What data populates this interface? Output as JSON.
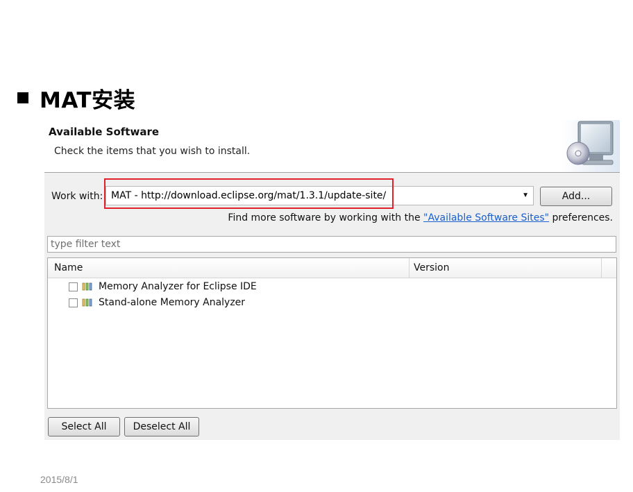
{
  "slide": {
    "title": "MAT安装",
    "date": "2015/8/1"
  },
  "dialog": {
    "title": "Available Software",
    "description": "Check the items that you wish to install.",
    "work_with_label": "Work with:",
    "work_with_value": "MAT - http://download.eclipse.org/mat/1.3.1/update-site/",
    "add_button": "Add...",
    "find_more_prefix": "Find more software by working with the ",
    "find_more_link": "\"Available Software Sites\"",
    "find_more_suffix": " preferences.",
    "filter_placeholder": "type filter text",
    "table": {
      "columns": [
        "Name",
        "Version"
      ],
      "rows": [
        {
          "name": "Memory Analyzer for Eclipse IDE",
          "version": "",
          "checked": false
        },
        {
          "name": "Stand-alone Memory Analyzer",
          "version": "",
          "checked": false
        }
      ]
    },
    "select_all_button": "Select All",
    "deselect_all_button": "Deselect All"
  },
  "colors": {
    "highlight": "#e0202a",
    "link": "#1a5fcc"
  },
  "icons": {
    "bullet": "black-square-bullet",
    "banner": "computer-monitor-with-cd-icon",
    "package": "installable-unit-icon",
    "dropdown": "triangle-down-icon"
  }
}
